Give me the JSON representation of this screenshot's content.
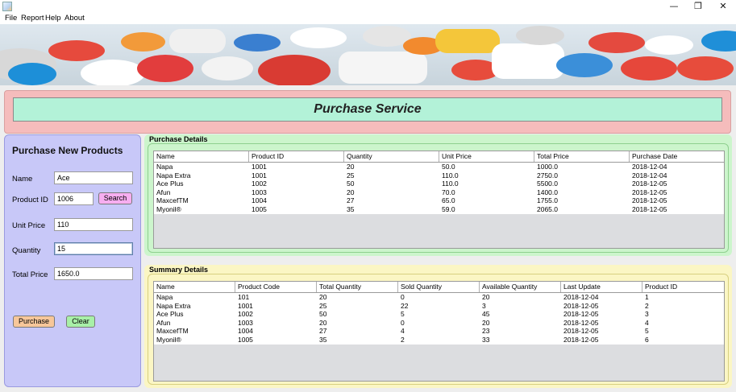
{
  "window": {
    "minimize_glyph": "—",
    "restore_glyph": "❐",
    "close_glyph": "✕"
  },
  "menu": [
    "File",
    "Report",
    "Help",
    "About"
  ],
  "header": {
    "title": "Purchase Service"
  },
  "form": {
    "title": "Purchase New Products",
    "name_label": "Name",
    "name_value": "Ace",
    "product_id_label": "Product ID",
    "product_id_value": "1006",
    "search_label": "Search",
    "unit_price_label": "Unit Price",
    "unit_price_value": "110",
    "quantity_label": "Quantity",
    "quantity_value": "15",
    "total_price_label": "Total Price",
    "total_price_value": "1650.0",
    "purchase_label": "Purchase",
    "clear_label": "Clear"
  },
  "purchase_details": {
    "title": "Purchase Details",
    "columns": [
      "Name",
      "Product ID",
      "Quantity",
      "Unit Price",
      "Total Price",
      "Purchase Date"
    ],
    "rows": [
      [
        "Napa",
        "1001",
        "20",
        "50.0",
        "1000.0",
        "2018-12-04"
      ],
      [
        "Napa Extra",
        "1001",
        "25",
        "110.0",
        "2750.0",
        "2018-12-04"
      ],
      [
        "Ace Plus",
        "1002",
        "50",
        "110.0",
        "5500.0",
        "2018-12-05"
      ],
      [
        "Afun",
        "1003",
        "20",
        "70.0",
        "1400.0",
        "2018-12-05"
      ],
      [
        "MaxcefTM",
        "1004",
        "27",
        "65.0",
        "1755.0",
        "2018-12-05"
      ],
      [
        "Myonil®",
        "1005",
        "35",
        "59.0",
        "2065.0",
        "2018-12-05"
      ]
    ]
  },
  "summary_details": {
    "title": "Summary Details",
    "columns": [
      "Name",
      "Product Code",
      "Total Quantity",
      "Sold Quantity",
      "Available Quantity",
      "Last Update",
      "Product ID"
    ],
    "rows": [
      [
        "Napa",
        "101",
        "20",
        "0",
        "20",
        "2018-12-04",
        "1"
      ],
      [
        "Napa Extra",
        "1001",
        "25",
        "22",
        "3",
        "2018-12-05",
        "2"
      ],
      [
        "Ace Plus",
        "1002",
        "50",
        "5",
        "45",
        "2018-12-05",
        "3"
      ],
      [
        "Afun",
        "1003",
        "20",
        "0",
        "20",
        "2018-12-05",
        "4"
      ],
      [
        "MaxcefTM",
        "1004",
        "27",
        "4",
        "23",
        "2018-12-05",
        "5"
      ],
      [
        "Myonil®",
        "1005",
        "35",
        "2",
        "33",
        "2018-12-05",
        "6"
      ]
    ]
  },
  "colors": {
    "title_outer": "#f5bcbc",
    "title_inner": "#b3f2d8",
    "form_panel": "#c8c8f8",
    "purchase_panel": "#ccf5cc",
    "summary_panel": "#fbf6c4",
    "search_button": "#f7aef0",
    "purchase_button": "#f7c79a",
    "clear_button": "#a8f0a8"
  }
}
